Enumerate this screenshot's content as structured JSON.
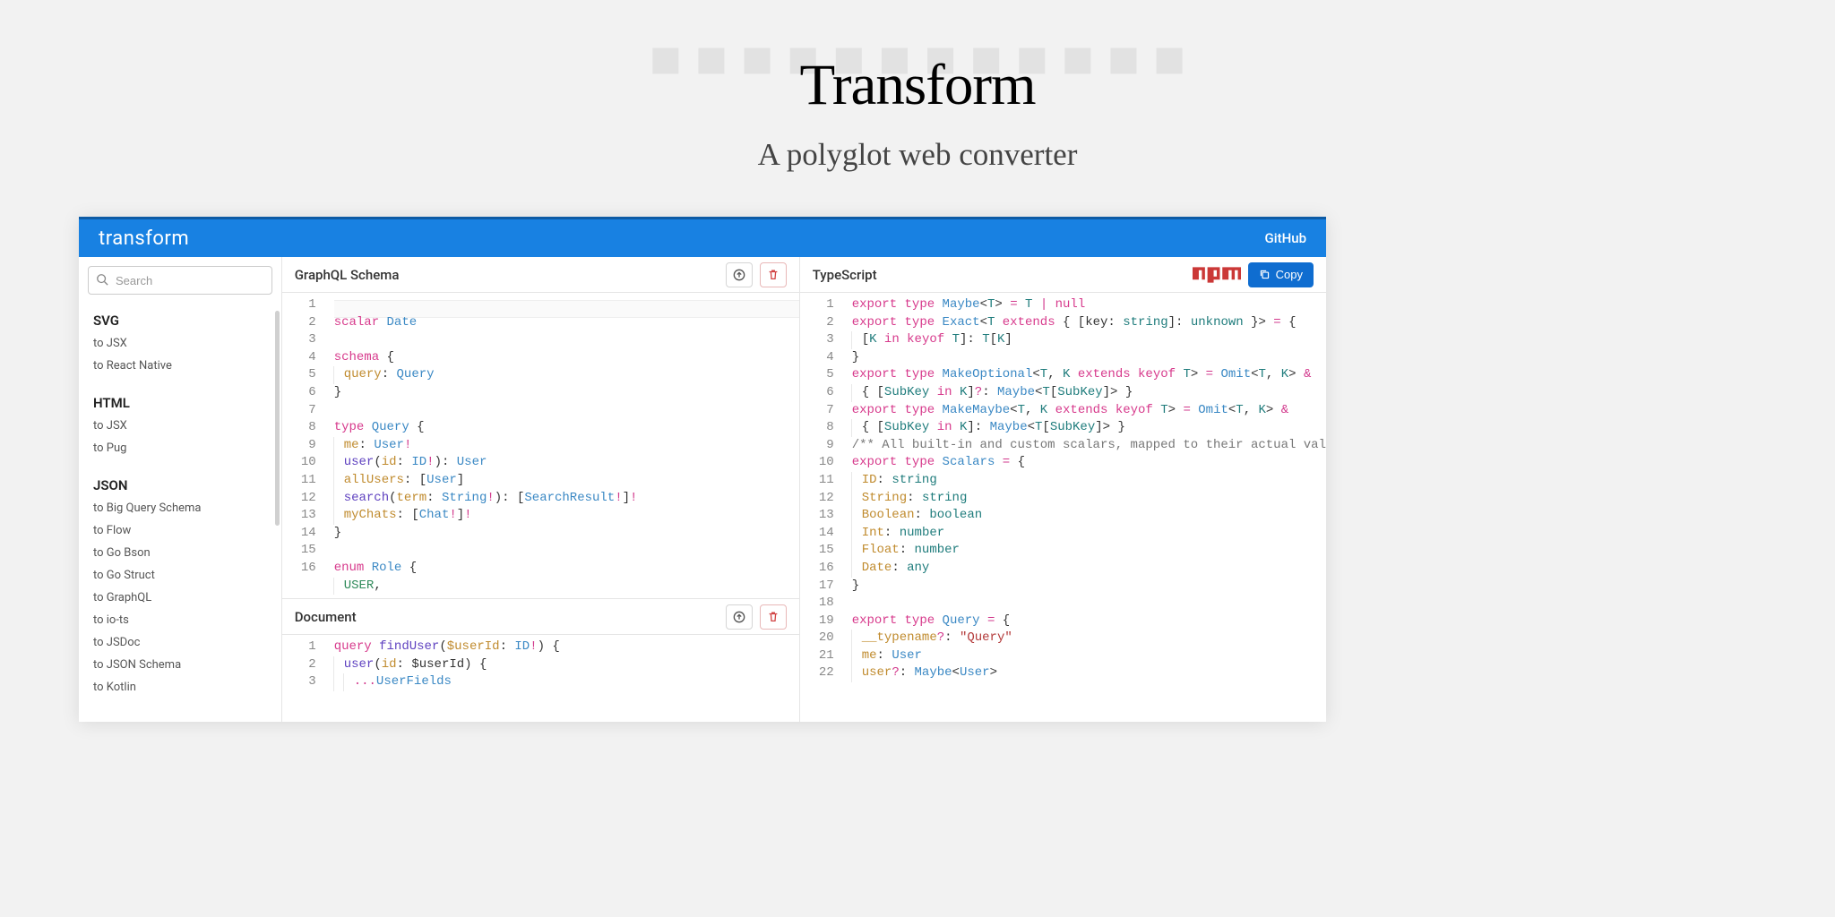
{
  "hero": {
    "title": "Transform",
    "subtitle": "A polyglot web converter"
  },
  "topbar": {
    "brand": "transform",
    "github": "GitHub"
  },
  "sidebar": {
    "search_placeholder": "Search",
    "groups": [
      {
        "title": "SVG",
        "items": [
          "to JSX",
          "to React Native"
        ]
      },
      {
        "title": "HTML",
        "items": [
          "to JSX",
          "to Pug"
        ]
      },
      {
        "title": "JSON",
        "items": [
          "to Big Query Schema",
          "to Flow",
          "to Go Bson",
          "to Go Struct",
          "to GraphQL",
          "to io-ts",
          "to JSDoc",
          "to JSON Schema",
          "to Kotlin"
        ]
      }
    ]
  },
  "panes": {
    "schema_title": "GraphQL Schema",
    "document_title": "Document",
    "output_title": "TypeScript",
    "copy_label": "Copy"
  },
  "code": {
    "schema": [
      {
        "n": 1,
        "html": "<span class='kw'>scalar</span> <span class='typ'>Date</span>"
      },
      {
        "n": 2,
        "html": ""
      },
      {
        "n": 3,
        "html": "<span class='kw'>schema</span> {"
      },
      {
        "n": 4,
        "html": "<span class='guide'><span class='prop'>query</span>: <span class='typ'>Query</span></span>"
      },
      {
        "n": 5,
        "html": "}"
      },
      {
        "n": 6,
        "html": ""
      },
      {
        "n": 7,
        "html": "<span class='kw'>type</span> <span class='typ'>Query</span> {"
      },
      {
        "n": 8,
        "html": "<span class='guide'><span class='prop'>me</span>: <span class='typ'>User</span><span class='op'>!</span></span>"
      },
      {
        "n": 9,
        "html": "<span class='guide'><span class='fn'>user</span>(<span class='prop'>id</span>: <span class='typ'>ID</span><span class='op'>!</span>): <span class='typ'>User</span></span>"
      },
      {
        "n": 10,
        "html": "<span class='guide'><span class='prop'>allUsers</span>: [<span class='typ'>User</span>]</span>"
      },
      {
        "n": 11,
        "html": "<span class='guide'><span class='fn'>search</span>(<span class='prop'>term</span>: <span class='typ'>String</span><span class='op'>!</span>): [<span class='typ'>SearchResult</span><span class='op'>!</span>]<span class='op'>!</span></span>"
      },
      {
        "n": 12,
        "html": "<span class='guide'><span class='prop'>myChats</span>: [<span class='typ'>Chat</span><span class='op'>!</span>]<span class='op'>!</span></span>"
      },
      {
        "n": 13,
        "html": "}"
      },
      {
        "n": 14,
        "html": ""
      },
      {
        "n": 15,
        "html": "<span class='kw'>enum</span> <span class='typ'>Role</span> {"
      },
      {
        "n": 16,
        "html": "<span class='guide'><span class='lit'>USER</span>,</span>"
      }
    ],
    "document": [
      {
        "n": 1,
        "html": "<span class='kw'>query</span> <span class='fn'>findUser</span>(<span class='prop'>$userId</span>: <span class='typ'>ID</span><span class='op'>!</span>) {"
      },
      {
        "n": 2,
        "html": "<span class='guide'><span class='fn'>user</span>(<span class='prop'>id</span>: $userId) {</span>"
      },
      {
        "n": 3,
        "html": "<span class='guide'><span class='guide'><span class='op'>...</span><span class='typ'>UserFields</span></span></span>"
      }
    ],
    "output": [
      {
        "n": 1,
        "html": "<span class='kw'>export</span> <span class='kw'>type</span> <span class='typ'>Maybe</span>&lt;<span class='teal'>T</span>&gt; <span class='op'>=</span> <span class='teal'>T</span> <span class='op'>|</span> <span class='kw'>null</span>"
      },
      {
        "n": 2,
        "html": "<span class='kw'>export</span> <span class='kw'>type</span> <span class='typ'>Exact</span>&lt;<span class='teal'>T</span> <span class='kw'>extends</span> { [key: <span class='teal'>string</span>]: <span class='teal'>unknown</span> }&gt; <span class='op'>=</span> {"
      },
      {
        "n": 3,
        "html": "<span class='guide'>[<span class='teal'>K</span> <span class='kw'>in</span> <span class='kw'>keyof</span> <span class='teal'>T</span>]: <span class='teal'>T</span>[<span class='teal'>K</span>]</span>"
      },
      {
        "n": 4,
        "html": "}"
      },
      {
        "n": 5,
        "html": "<span class='kw'>export</span> <span class='kw'>type</span> <span class='typ'>MakeOptional</span>&lt;<span class='teal'>T</span>, <span class='teal'>K</span> <span class='kw'>extends</span> <span class='kw'>keyof</span> <span class='teal'>T</span>&gt; <span class='op'>=</span> <span class='typ'>Omit</span>&lt;<span class='teal'>T</span>, <span class='teal'>K</span>&gt; <span class='op'>&amp;</span>"
      },
      {
        "n": 6,
        "html": "<span class='guide'>{ [<span class='teal'>SubKey</span> <span class='kw'>in</span> <span class='teal'>K</span>]<span class='op'>?</span>: <span class='typ'>Maybe</span>&lt;<span class='teal'>T</span>[<span class='teal'>SubKey</span>]&gt; }</span>"
      },
      {
        "n": 7,
        "html": "<span class='kw'>export</span> <span class='kw'>type</span> <span class='typ'>MakeMaybe</span>&lt;<span class='teal'>T</span>, <span class='teal'>K</span> <span class='kw'>extends</span> <span class='kw'>keyof</span> <span class='teal'>T</span>&gt; <span class='op'>=</span> <span class='typ'>Omit</span>&lt;<span class='teal'>T</span>, <span class='teal'>K</span>&gt; <span class='op'>&amp;</span>"
      },
      {
        "n": 8,
        "html": "<span class='guide'>{ [<span class='teal'>SubKey</span> <span class='kw'>in</span> <span class='teal'>K</span>]: <span class='typ'>Maybe</span>&lt;<span class='teal'>T</span>[<span class='teal'>SubKey</span>]&gt; }</span>"
      },
      {
        "n": 9,
        "html": "<span class='com'>/** All built-in and custom scalars, mapped to their actual val</span>"
      },
      {
        "n": 10,
        "html": "<span class='kw'>export</span> <span class='kw'>type</span> <span class='typ'>Scalars</span> <span class='op'>=</span> {"
      },
      {
        "n": 11,
        "html": "<span class='guide'><span class='prop'>ID</span>: <span class='teal'>string</span></span>"
      },
      {
        "n": 12,
        "html": "<span class='guide'><span class='prop'>String</span>: <span class='teal'>string</span></span>"
      },
      {
        "n": 13,
        "html": "<span class='guide'><span class='prop'>Boolean</span>: <span class='teal'>boolean</span></span>"
      },
      {
        "n": 14,
        "html": "<span class='guide'><span class='prop'>Int</span>: <span class='teal'>number</span></span>"
      },
      {
        "n": 15,
        "html": "<span class='guide'><span class='prop'>Float</span>: <span class='teal'>number</span></span>"
      },
      {
        "n": 16,
        "html": "<span class='guide'><span class='prop'>Date</span>: <span class='teal'>any</span></span>"
      },
      {
        "n": 17,
        "html": "}"
      },
      {
        "n": 18,
        "html": ""
      },
      {
        "n": 19,
        "html": "<span class='kw'>export</span> <span class='kw'>type</span> <span class='typ'>Query</span> <span class='op'>=</span> {"
      },
      {
        "n": 20,
        "html": "<span class='guide'><span class='prop'>__typename</span><span class='op'>?</span>: <span class='str'>&quot;Query&quot;</span></span>"
      },
      {
        "n": 21,
        "html": "<span class='guide'><span class='prop'>me</span>: <span class='typ'>User</span></span>"
      },
      {
        "n": 22,
        "html": "<span class='guide'><span class='prop'>user</span><span class='op'>?</span>: <span class='typ'>Maybe</span>&lt;<span class='typ'>User</span>&gt;</span>"
      }
    ]
  }
}
